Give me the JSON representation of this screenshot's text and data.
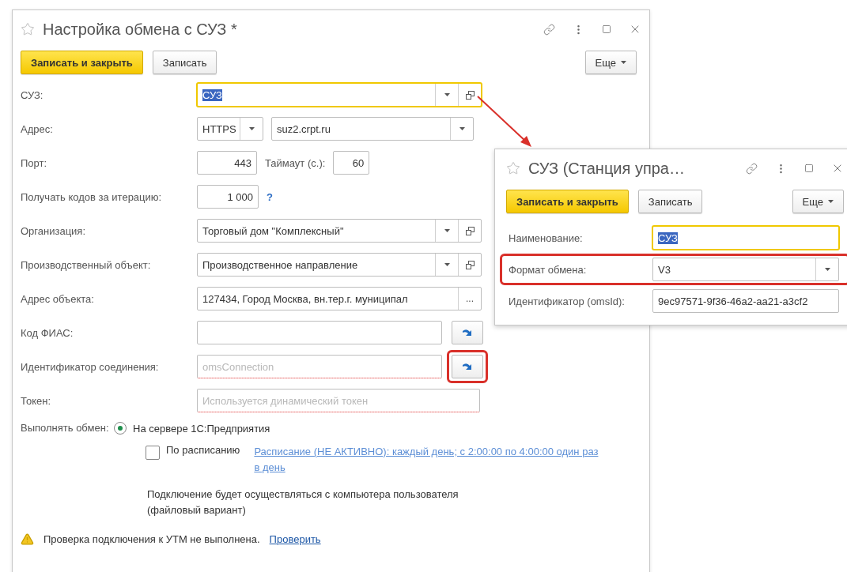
{
  "main_window": {
    "title": "Настройка обмена с СУЗ *",
    "buttons": [
      {
        "label": "Записать и закрыть",
        "kind": "primary"
      },
      {
        "label": "Записать",
        "kind": "default"
      }
    ],
    "more_button": "Еще",
    "fields": [
      {
        "label": "СУЗ:",
        "kind": "ref",
        "value": "СУЗ",
        "focused": true,
        "text_selected": true
      },
      {
        "label": "Адрес:",
        "kind": "address",
        "protocol": "HTTPS",
        "value": "suz2.crpt.ru"
      },
      {
        "label": "Порт:",
        "kind": "port",
        "value": "443",
        "timeout_label": "Таймаут (с.):",
        "timeout": "60"
      },
      {
        "label": "Получать кодов за итерацию:",
        "kind": "count",
        "value": "1 000",
        "help": "?"
      },
      {
        "label": "Организация:",
        "kind": "ref",
        "value": "Торговый дом \"Комплексный\"",
        "focused": false,
        "text_selected": false
      },
      {
        "label": "Производственный объект:",
        "kind": "ref",
        "value": "Производственное направление",
        "focused": false,
        "text_selected": false
      },
      {
        "label": "Адрес объекта:",
        "kind": "picker",
        "value": "127434, Город Москва, вн.тер.г. муниципал",
        "button": "..."
      },
      {
        "label": "Код ФИАС:",
        "kind": "fill",
        "required": false,
        "highlighted": false
      },
      {
        "label": "Идентификатор соединения:",
        "kind": "fill",
        "placeholder": "omsConnection",
        "required": true,
        "highlighted": true
      },
      {
        "label": "Токен:",
        "kind": "plain",
        "placeholder": "Используется динамический токен",
        "required": true
      }
    ],
    "exchange": {
      "label": "Выполнять обмен:",
      "radio": {
        "label": "На сервере 1С:Предприятия",
        "selected": true
      },
      "schedule": {
        "label": "По расписанию",
        "checked": false,
        "link": "Расписание (НЕ АКТИВНО): каждый день; с 2:00:00 по 4:00:00 один раз в день"
      },
      "note": "Подключение будет осуществляться с компьютера пользователя (файловый вариант)"
    },
    "warning": {
      "text": "Проверка подключения к УТМ не выполнена.",
      "link": "Проверить"
    }
  },
  "popup_window": {
    "title": "СУЗ (Станция упра…",
    "buttons": [
      {
        "label": "Записать и закрыть",
        "kind": "primary"
      },
      {
        "label": "Записать",
        "kind": "default"
      }
    ],
    "more_button": "Еще",
    "fields": [
      {
        "label": "Наименование:",
        "kind": "text",
        "value": "СУЗ",
        "focused": true,
        "text_selected": true,
        "highlighted": false
      },
      {
        "label": "Формат обмена:",
        "kind": "select",
        "value": "V3",
        "focused": false,
        "text_selected": false,
        "highlighted": true
      },
      {
        "label": "Идентификатор (omsId):",
        "kind": "text",
        "value": "9ec97571-9f36-46a2-aa21-a3cf2",
        "focused": false,
        "text_selected": false,
        "highlighted": false
      }
    ]
  }
}
